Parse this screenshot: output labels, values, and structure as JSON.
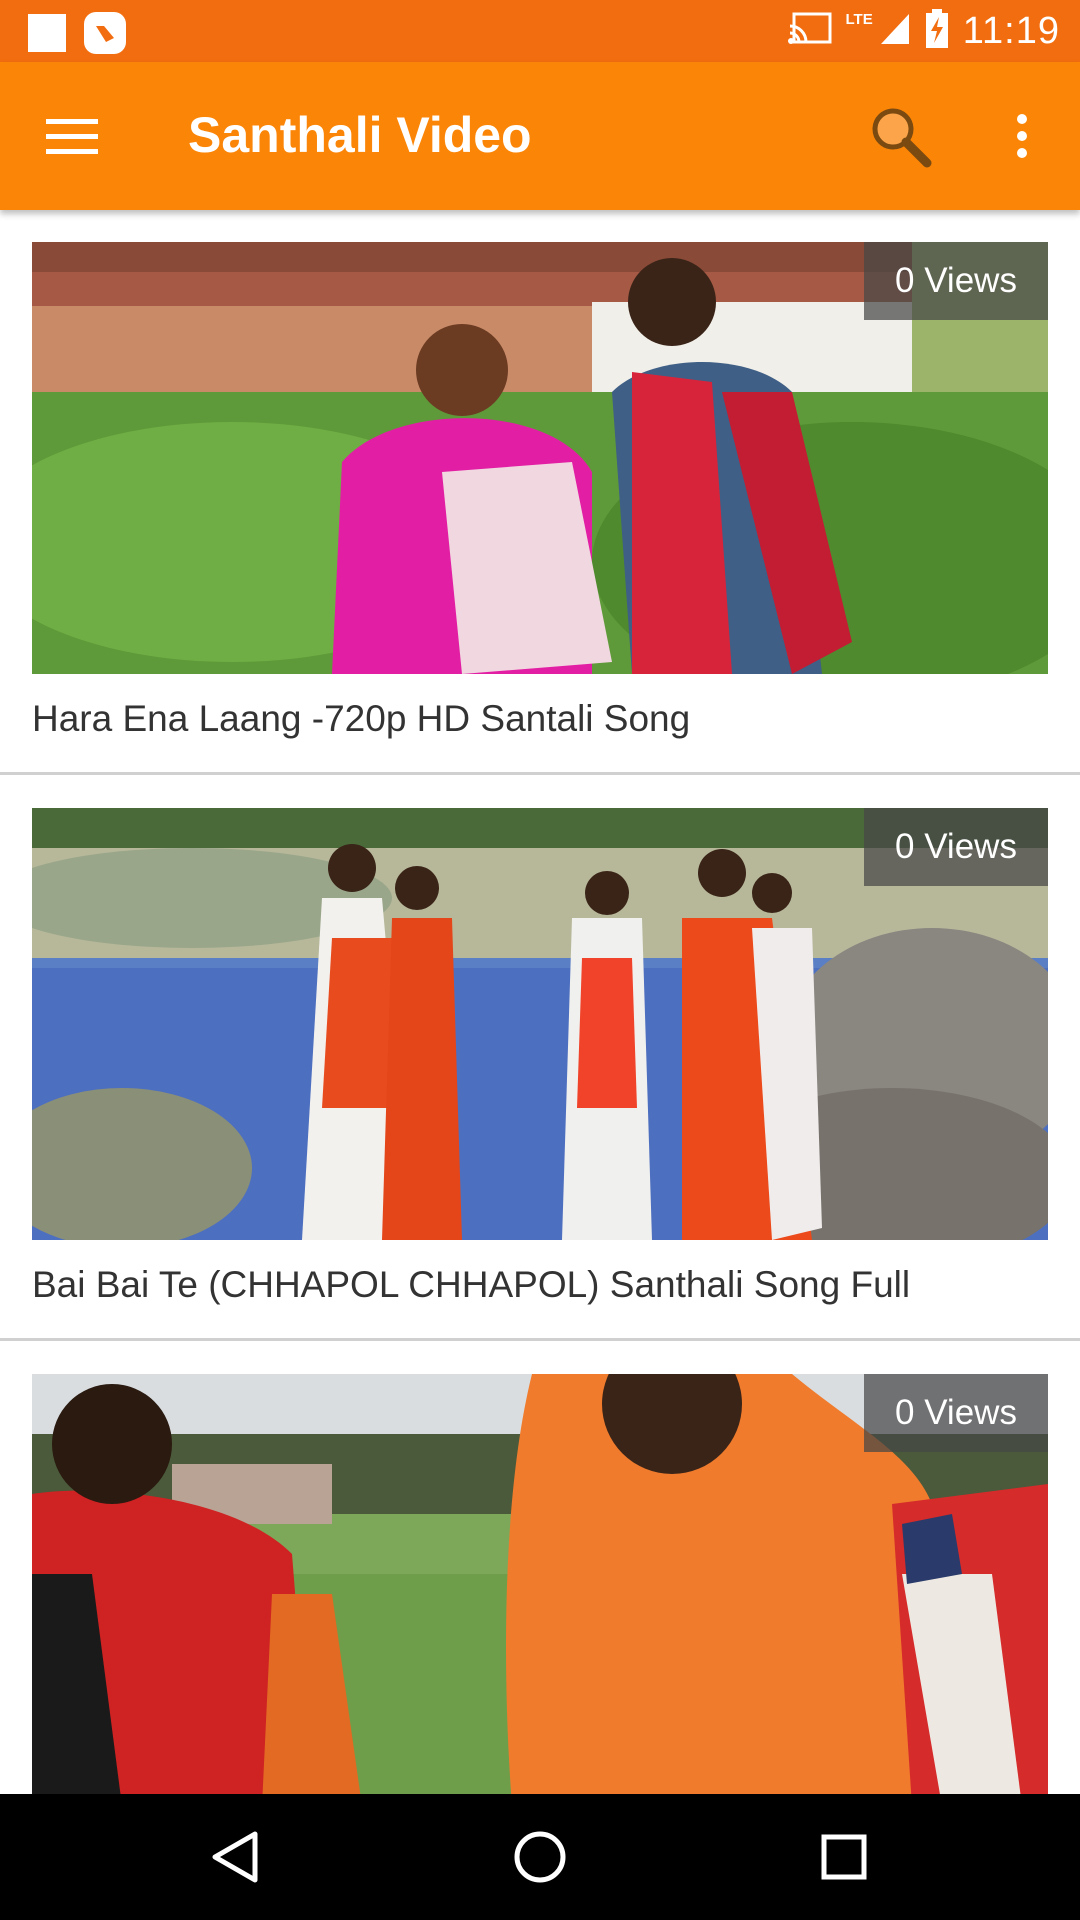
{
  "status_bar": {
    "time": "11:19",
    "network": "LTE",
    "icons": [
      "notification-square-icon",
      "app-notification-icon",
      "cast-icon",
      "signal-icon",
      "battery-charging-icon"
    ]
  },
  "app_bar": {
    "title": "Santhali Video",
    "icons": [
      "menu-icon",
      "search-icon",
      "more-vert-icon"
    ],
    "color": "#fb8507"
  },
  "videos": [
    {
      "title": "Hara Ena Laang -720p HD Santali Song",
      "views": "0 Views"
    },
    {
      "title": "Bai Bai Te (CHHAPOL CHHAPOL) Santhali Song Full",
      "views": "0 Views"
    },
    {
      "title": "",
      "views": "0 Views"
    }
  ],
  "nav_bar": {
    "icons": [
      "back-icon",
      "home-icon",
      "recents-icon"
    ]
  }
}
